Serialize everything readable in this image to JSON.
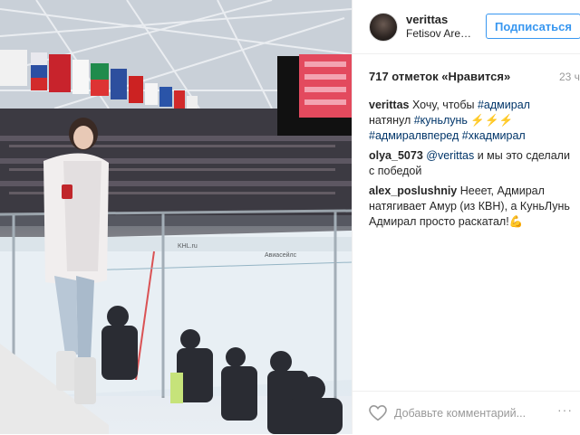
{
  "header": {
    "username": "verittas",
    "location": "Fetisov Are…",
    "follow_label": "Подписаться"
  },
  "post": {
    "likes": "717 отметок «Нравится»",
    "time": "23 ч"
  },
  "photo": {
    "banner_left": "KHL.ru",
    "banner_right": "Авиасейлс"
  },
  "comments": [
    {
      "user": "verittas",
      "parts": [
        {
          "t": "Хочу, чтобы ",
          "tag": false
        },
        {
          "t": "#адмирал",
          "tag": true
        },
        {
          "t": " натянул ",
          "tag": false
        },
        {
          "t": "#куньлунь",
          "tag": true
        },
        {
          "t": " ⚡⚡⚡ ",
          "tag": false
        },
        {
          "t": "#адмиралвперед",
          "tag": true
        },
        {
          "t": " ",
          "tag": false
        },
        {
          "t": "#хкадмирал",
          "tag": true
        }
      ]
    },
    {
      "user": "olya_5073",
      "parts": [
        {
          "t": "@verittas",
          "tag": true
        },
        {
          "t": " и мы это сделали с победой",
          "tag": false
        }
      ]
    },
    {
      "user": "alex_poslushniy",
      "parts": [
        {
          "t": "Нееет, Адмирал натягивает Амур (из КВН), а КуньЛунь Адмирал просто раскатал!💪",
          "tag": false
        }
      ]
    }
  ],
  "add_comment": {
    "placeholder": "Добавьте комментарий...",
    "more": "···"
  },
  "icons": {
    "heart": "heart-icon",
    "more": "more-options-icon"
  },
  "colors": {
    "accent": "#3897f0",
    "hashtag": "#003569"
  }
}
